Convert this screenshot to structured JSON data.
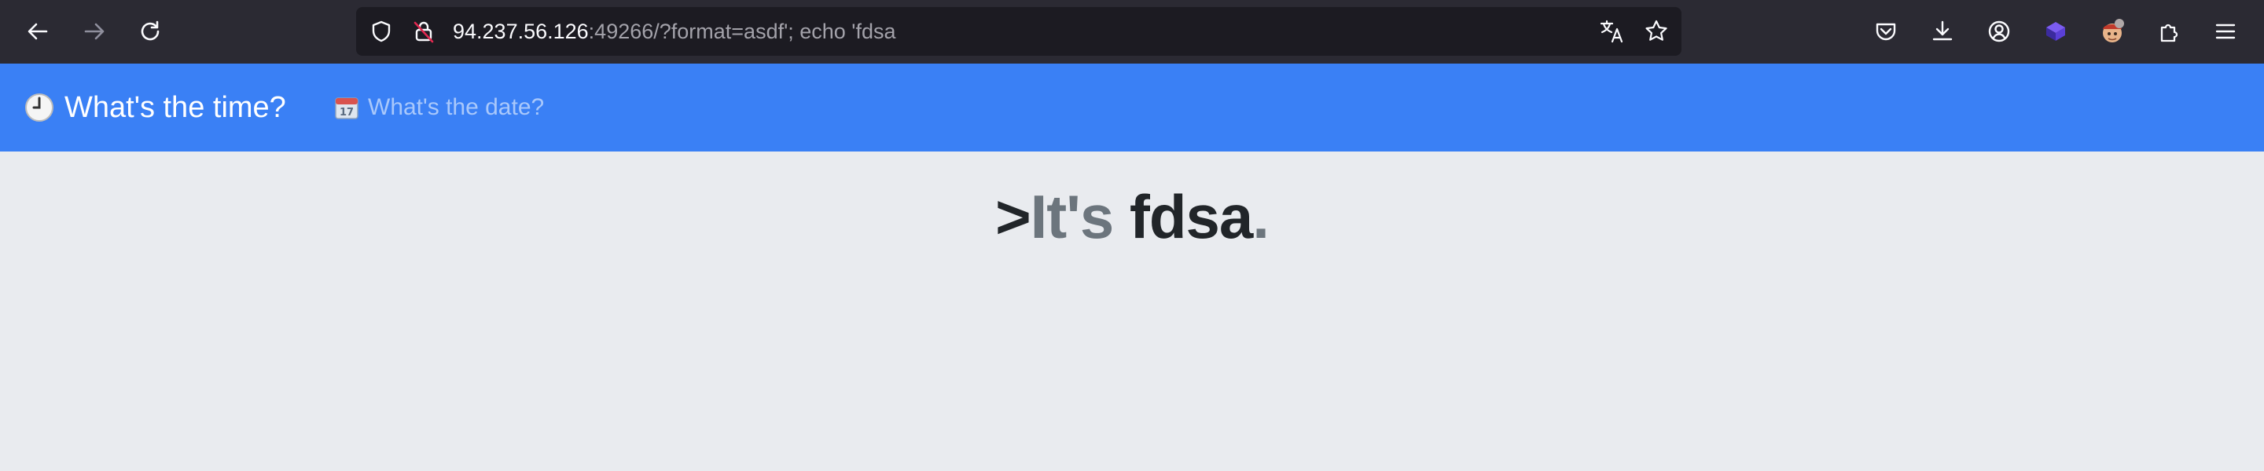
{
  "browser": {
    "url_host": "94.237.56.126",
    "url_rest": ":49266/?format=asdf'; echo 'fdsa",
    "icons": {
      "back": "back-arrow-icon",
      "forward": "forward-arrow-icon",
      "reload": "reload-icon",
      "shield": "tracking-shield-icon",
      "insecure_lock": "insecure-lock-icon",
      "translate": "translate-icon",
      "bookmark": "bookmark-star-icon",
      "pocket": "pocket-icon",
      "downloads": "download-icon",
      "account": "account-icon",
      "extension_purple": "extension-cube-icon",
      "extension_avatar": "extension-avatar-icon",
      "extensions": "puzzle-piece-icon",
      "menu": "hamburger-menu-icon"
    },
    "colors": {
      "toolbar_bg": "#2b2a33",
      "urlbar_bg": "#1c1b22"
    }
  },
  "app": {
    "brand_emoji": "🕒",
    "brand_title": "What's the time?",
    "nav_emoji": "📅",
    "nav_date_link": "What's the date?",
    "colors": {
      "navbar_bg": "#3a80f5",
      "page_bg": "#e9ebef"
    }
  },
  "main": {
    "prompt": ">",
    "prefix": "It's",
    "value": "fdsa",
    "suffix": "."
  }
}
